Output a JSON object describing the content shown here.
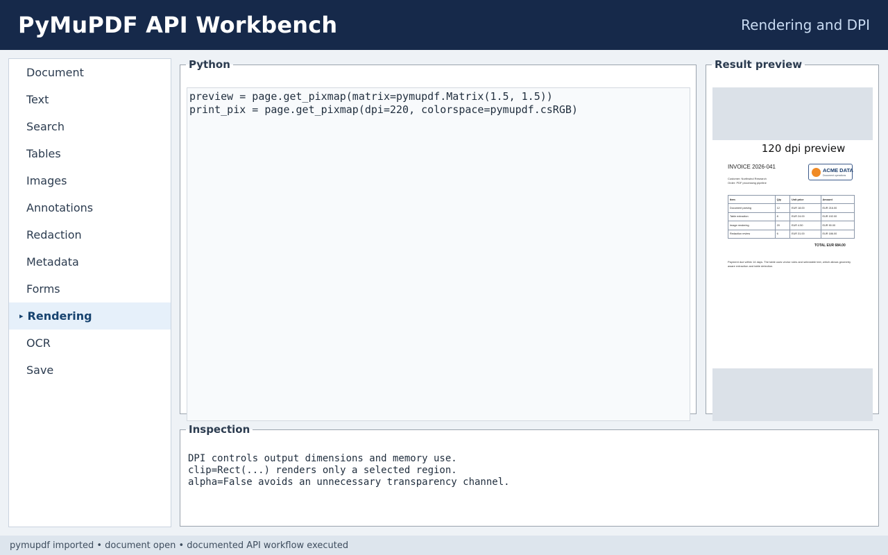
{
  "header": {
    "title": "PyMuPDF API Workbench",
    "subtitle": "Rendering and DPI"
  },
  "sidebar": {
    "items": [
      {
        "label": "Document",
        "active": false
      },
      {
        "label": "Text",
        "active": false
      },
      {
        "label": "Search",
        "active": false
      },
      {
        "label": "Tables",
        "active": false
      },
      {
        "label": "Images",
        "active": false
      },
      {
        "label": "Annotations",
        "active": false
      },
      {
        "label": "Redaction",
        "active": false
      },
      {
        "label": "Metadata",
        "active": false
      },
      {
        "label": "Forms",
        "active": false
      },
      {
        "label": "Rendering",
        "active": true
      },
      {
        "label": "OCR",
        "active": false
      },
      {
        "label": "Save",
        "active": false
      }
    ],
    "active_marker": "▸"
  },
  "python": {
    "legend": "Python",
    "code": "preview = page.get_pixmap(matrix=pymupdf.Matrix(1.5, 1.5))\nprint_pix = page.get_pixmap(dpi=220, colorspace=pymupdf.csRGB)"
  },
  "preview": {
    "legend": "Result preview",
    "label": "120 dpi preview",
    "invoice": {
      "title": "INVOICE 2026-041",
      "customer": "Customer: Northwind Research",
      "order": "Order: PDF processing pipeline",
      "logo_name": "ACME DATA",
      "logo_sub": "Document operations",
      "headers": [
        "Item",
        "Qty",
        "Unit price",
        "Amount"
      ],
      "rows": [
        [
          "Document parsing",
          "12",
          "EUR 18.00",
          "EUR 216.00"
        ],
        [
          "Table extraction",
          "8",
          "EUR 24.00",
          "EUR 192.00"
        ],
        [
          "Image rendering",
          "20",
          "EUR 4.50",
          "EUR 90.00"
        ],
        [
          "Redaction review",
          "6",
          "EUR 31.00",
          "EUR 186.00"
        ]
      ],
      "total": "TOTAL  EUR 684.00",
      "note": "Payment due within 14 days. The table uses vector rules and selectable text, which allows geometry aware extraction and table detection."
    }
  },
  "inspection": {
    "legend": "Inspection",
    "lines": [
      "DPI controls output dimensions and memory use.",
      "clip=Rect(...) renders only a selected region.",
      "alpha=False avoids an unnecessary transparency channel."
    ]
  },
  "status": {
    "text": "pymupdf imported • document open • documented API workflow executed"
  },
  "colors": {
    "header_bg": "#16294a",
    "active_nav_bg": "#e6f0fa",
    "active_nav_text": "#17436f",
    "logo_orange": "#f08a24"
  }
}
